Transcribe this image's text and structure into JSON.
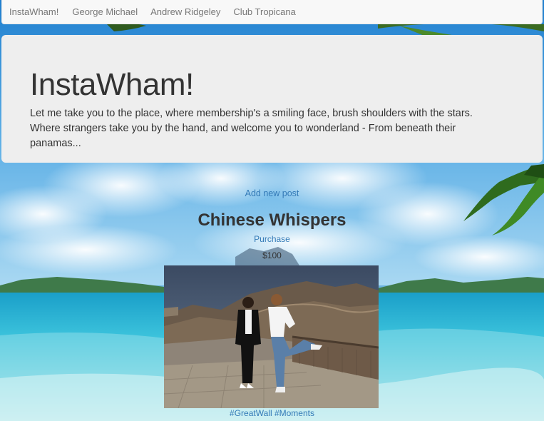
{
  "navbar": {
    "brand": "InstaWham!",
    "links": [
      "George Michael",
      "Andrew Ridgeley",
      "Club Tropicana"
    ]
  },
  "jumbotron": {
    "title": "InstaWham!",
    "text": "Let me take you to the place, where membership's a smiling face, brush shoulders with the stars. Where strangers take you by the hand, and welcome you to wonderland - From beneath their panamas..."
  },
  "actions": {
    "add_post": "Add new post"
  },
  "post": {
    "title": "Chinese Whispers",
    "purchase_label": "Purchase",
    "price": "$100",
    "tags": "#GreatWall #Moments"
  },
  "colors": {
    "link": "#337ab7",
    "navbar_bg": "#f8f8f8",
    "jumbotron_bg": "#eeeeee",
    "text": "#333333"
  }
}
